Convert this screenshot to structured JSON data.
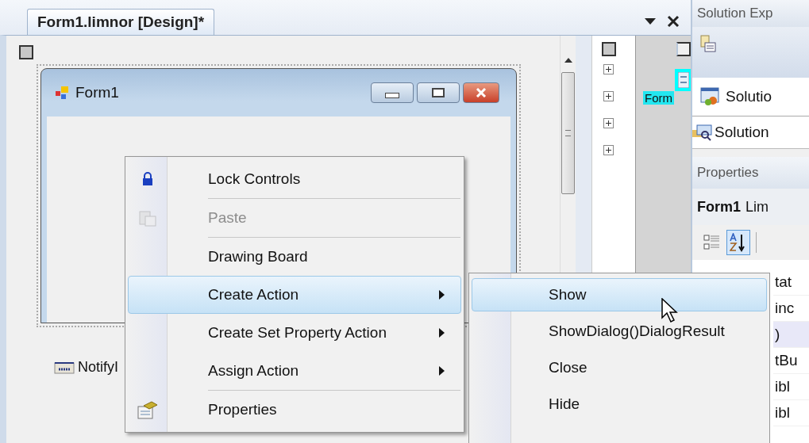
{
  "document_tab": {
    "title": "Form1.limnor [Design]*",
    "selected": true
  },
  "form": {
    "title": "Form1"
  },
  "component_tray": [
    {
      "label": "NotifyI"
    }
  ],
  "tree_nodes": [
    {
      "expanded": false
    },
    {
      "expanded": false
    },
    {
      "expanded": false
    },
    {
      "expanded": false
    }
  ],
  "selected_component": {
    "label": "Form"
  },
  "solution_explorer": {
    "title": "Solution Exp",
    "tree_item": "Solutio",
    "tab": "Solution"
  },
  "properties": {
    "title": "Properties",
    "object": "Form1",
    "object_type": "Lim",
    "sort_buttons": [
      {
        "kind": "categorized",
        "selected": false
      },
      {
        "kind": "alphabetical",
        "selected": true
      }
    ],
    "rows": [
      {
        "text": "tat",
        "selected": false
      },
      {
        "text": "inc",
        "selected": false
      },
      {
        "text": ")",
        "selected": true
      },
      {
        "text": "tBu",
        "selected": false
      },
      {
        "text": "ibl",
        "selected": false
      },
      {
        "text": "ibl",
        "selected": false
      }
    ]
  },
  "context_menu": [
    {
      "kind": "item",
      "label": "Lock Controls",
      "disabled": false,
      "submenu": false,
      "selected": false
    },
    {
      "kind": "separator"
    },
    {
      "kind": "item",
      "label": "Paste",
      "disabled": true,
      "submenu": false,
      "selected": false
    },
    {
      "kind": "separator"
    },
    {
      "kind": "item",
      "label": "Drawing Board",
      "disabled": false,
      "submenu": false,
      "selected": false
    },
    {
      "kind": "item",
      "label": "Create Action",
      "disabled": false,
      "submenu": true,
      "selected": true
    },
    {
      "kind": "item",
      "label": "Create Set Property Action",
      "disabled": false,
      "submenu": true,
      "selected": false
    },
    {
      "kind": "item",
      "label": "Assign Action",
      "disabled": false,
      "submenu": true,
      "selected": false
    },
    {
      "kind": "separator"
    },
    {
      "kind": "item",
      "label": "Properties",
      "disabled": false,
      "submenu": false,
      "selected": false
    }
  ],
  "submenu": [
    {
      "label": "Show",
      "selected": true
    },
    {
      "label": "ShowDialog()DialogResult",
      "selected": false
    },
    {
      "label": "Close",
      "selected": false
    },
    {
      "label": "Hide",
      "selected": false
    }
  ]
}
